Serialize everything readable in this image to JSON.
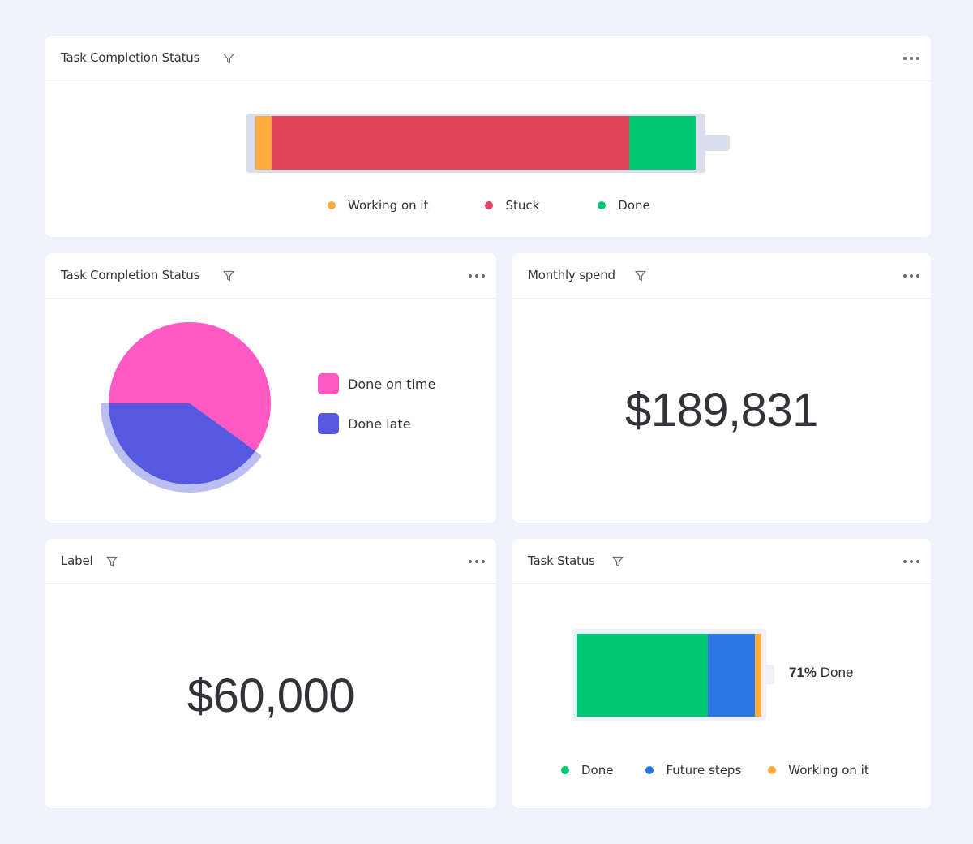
{
  "background_color": "#f0f2fd",
  "cards": {
    "top": {
      "title": "Task Completion Status",
      "filter_icon": "filter-icon",
      "menu_icon": "more-horizontal-icon"
    },
    "pie": {
      "title": "Task Completion Status",
      "filter_icon": "filter-icon",
      "menu_icon": "more-horizontal-icon"
    },
    "spend": {
      "title": "Monthly spend",
      "value": "$189,831",
      "filter_icon": "filter-icon",
      "menu_icon": "more-horizontal-icon"
    },
    "label": {
      "title": "Label",
      "value": "$60,000",
      "filter_icon": "filter-icon",
      "menu_icon": "more-horizontal-icon"
    },
    "status": {
      "title": "Task Status",
      "percent_value": "71%",
      "percent_suffix": "Done",
      "filter_icon": "filter-icon",
      "menu_icon": "more-horizontal-icon"
    }
  },
  "chart_data": [
    {
      "type": "bar",
      "subtype": "stacked-battery",
      "title": "Task Completion Status",
      "categories": [
        "Working on it",
        "Stuck",
        "Done"
      ],
      "values": [
        3.7,
        81.2,
        15.1
      ],
      "unit": "percent",
      "colors": [
        "#fdab3d",
        "#e2445c",
        "#00c875"
      ],
      "legend": [
        "Working on it",
        "Stuck",
        "Done"
      ],
      "legend_colors": [
        "#fdab3d",
        "#e2445c",
        "#00c875"
      ],
      "legend_position": "bottom"
    },
    {
      "type": "pie",
      "title": "Task Completion Status",
      "categories": [
        "Done on time",
        "Done late"
      ],
      "values": [
        60,
        40
      ],
      "unit": "percent",
      "colors": [
        "#ff5ac4",
        "#5559df"
      ],
      "highlight_color": "#bbbef0",
      "legend_position": "right"
    },
    {
      "type": "bar",
      "subtype": "stacked-battery",
      "title": "Task Status",
      "categories": [
        "Done",
        "Future steps",
        "Working on it"
      ],
      "values": [
        71,
        25.5,
        3.5
      ],
      "unit": "percent",
      "colors": [
        "#00c875",
        "#2b76e5",
        "#fdab3d"
      ],
      "legend": [
        "Done",
        "Future steps",
        "Working on it"
      ],
      "legend_position": "bottom"
    }
  ]
}
